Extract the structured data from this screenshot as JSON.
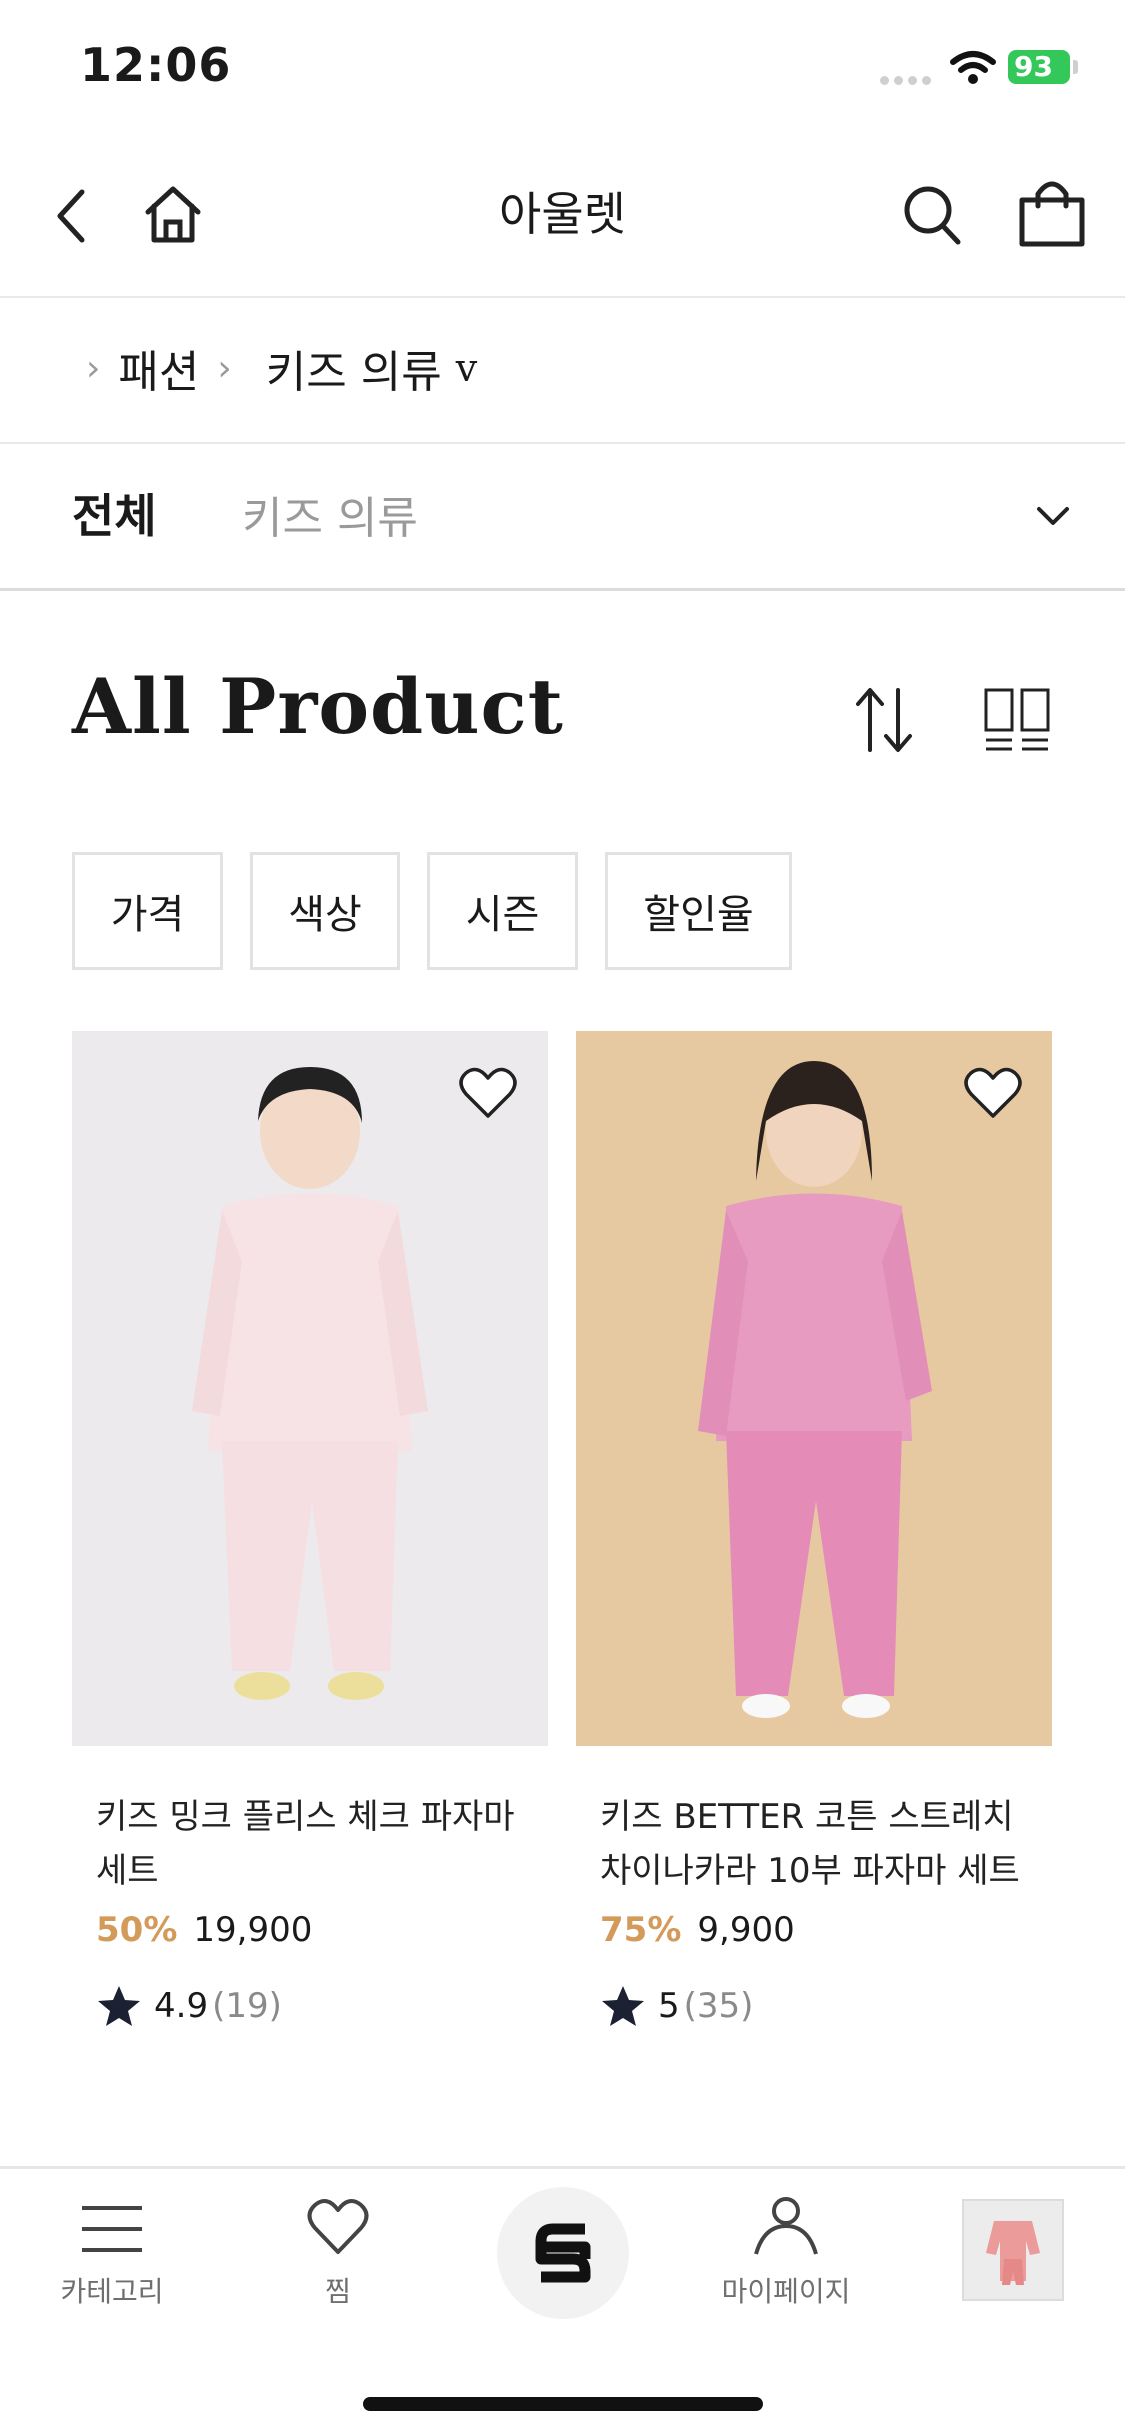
{
  "status_bar": {
    "time": "12:06",
    "battery": "93"
  },
  "header": {
    "title": "아울렛"
  },
  "breadcrumb": {
    "level1": "패션",
    "level2": "키즈 의류",
    "dropdown_glyph": "v"
  },
  "filter_bar": {
    "all_label": "전체",
    "sub_label": "키즈 의류"
  },
  "section": {
    "title": "All Product"
  },
  "filter_chips": [
    "가격",
    "색상",
    "시즌",
    "할인율"
  ],
  "products": [
    {
      "title_line1": "키즈 밍크 플리스 체크 파자마",
      "title_line2": "세트",
      "discount": "50%",
      "price": "19,900",
      "rating": "4.9",
      "reviews": "(19)",
      "image_bg": "#eceaec"
    },
    {
      "title_line1": "키즈 BETTER 코튼 스트레치",
      "title_line2": "차이나카라 10부 파자마 세트",
      "discount": "75%",
      "price": "9,900",
      "rating": "5",
      "reviews": "(35)",
      "image_bg": "#e7c9a1"
    }
  ],
  "tab_bar": {
    "category": "카테고리",
    "wishlist": "찜",
    "mypage": "마이페이지"
  },
  "colors": {
    "accent_discount": "#d49a5a",
    "battery": "#34c759"
  }
}
